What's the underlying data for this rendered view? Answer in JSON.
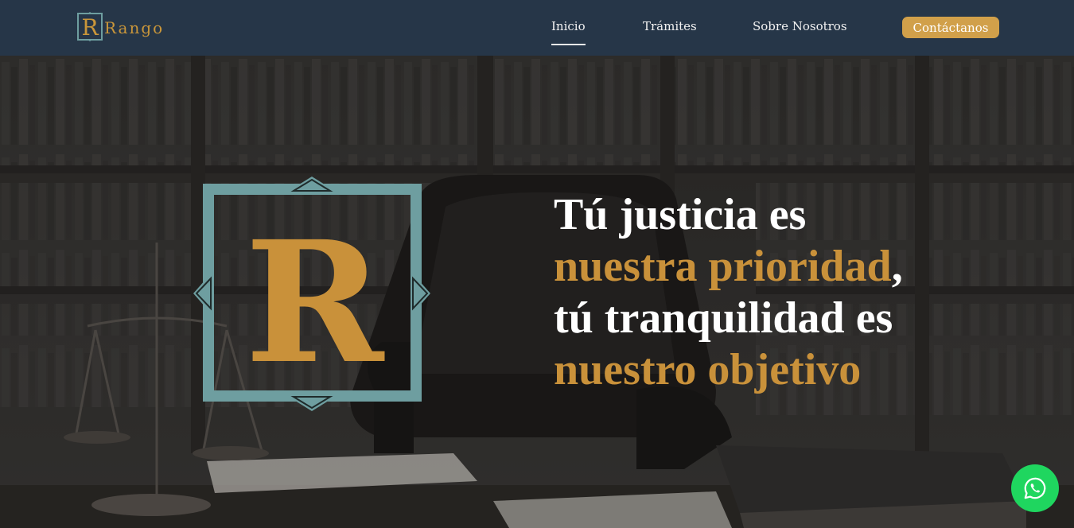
{
  "brand": {
    "name": "Rango",
    "logo_letter": "R",
    "color": "#c9963a"
  },
  "nav": {
    "items": [
      {
        "label": "Inicio",
        "active": true
      },
      {
        "label": "Trámites",
        "active": false
      },
      {
        "label": "Sobre Nosotros",
        "active": false
      }
    ],
    "contact_label": "Contáctanos"
  },
  "hero": {
    "line1": "Tú justicia es",
    "line2_highlight": "nuestra prioridad",
    "line2_suffix": ",",
    "line3": "tú tranquilidad es",
    "line4_highlight": "nuestro objetivo",
    "emblem_letter": "R",
    "background_scene": "law-office-library-icon"
  },
  "floating": {
    "whatsapp_icon": "whatsapp-icon"
  },
  "colors": {
    "navbar": "#263648",
    "gold": "#c9913a",
    "button": "#d1a04a",
    "teal": "#6e9ea0",
    "whatsapp": "#1fd65f"
  }
}
